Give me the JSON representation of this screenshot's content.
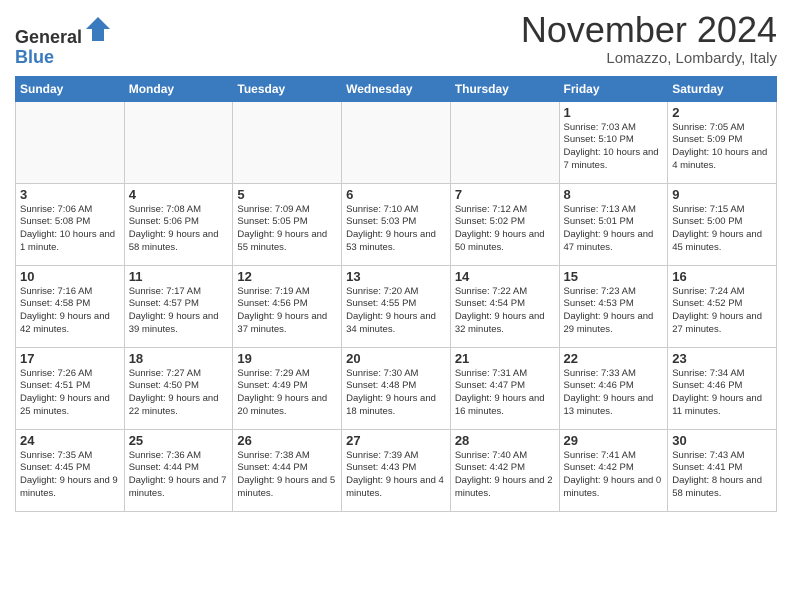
{
  "header": {
    "logo_line1": "General",
    "logo_line2": "Blue",
    "month": "November 2024",
    "location": "Lomazzo, Lombardy, Italy"
  },
  "weekdays": [
    "Sunday",
    "Monday",
    "Tuesday",
    "Wednesday",
    "Thursday",
    "Friday",
    "Saturday"
  ],
  "weeks": [
    [
      {
        "day": "",
        "info": ""
      },
      {
        "day": "",
        "info": ""
      },
      {
        "day": "",
        "info": ""
      },
      {
        "day": "",
        "info": ""
      },
      {
        "day": "",
        "info": ""
      },
      {
        "day": "1",
        "info": "Sunrise: 7:03 AM\nSunset: 5:10 PM\nDaylight: 10 hours and 7 minutes."
      },
      {
        "day": "2",
        "info": "Sunrise: 7:05 AM\nSunset: 5:09 PM\nDaylight: 10 hours and 4 minutes."
      }
    ],
    [
      {
        "day": "3",
        "info": "Sunrise: 7:06 AM\nSunset: 5:08 PM\nDaylight: 10 hours and 1 minute."
      },
      {
        "day": "4",
        "info": "Sunrise: 7:08 AM\nSunset: 5:06 PM\nDaylight: 9 hours and 58 minutes."
      },
      {
        "day": "5",
        "info": "Sunrise: 7:09 AM\nSunset: 5:05 PM\nDaylight: 9 hours and 55 minutes."
      },
      {
        "day": "6",
        "info": "Sunrise: 7:10 AM\nSunset: 5:03 PM\nDaylight: 9 hours and 53 minutes."
      },
      {
        "day": "7",
        "info": "Sunrise: 7:12 AM\nSunset: 5:02 PM\nDaylight: 9 hours and 50 minutes."
      },
      {
        "day": "8",
        "info": "Sunrise: 7:13 AM\nSunset: 5:01 PM\nDaylight: 9 hours and 47 minutes."
      },
      {
        "day": "9",
        "info": "Sunrise: 7:15 AM\nSunset: 5:00 PM\nDaylight: 9 hours and 45 minutes."
      }
    ],
    [
      {
        "day": "10",
        "info": "Sunrise: 7:16 AM\nSunset: 4:58 PM\nDaylight: 9 hours and 42 minutes."
      },
      {
        "day": "11",
        "info": "Sunrise: 7:17 AM\nSunset: 4:57 PM\nDaylight: 9 hours and 39 minutes."
      },
      {
        "day": "12",
        "info": "Sunrise: 7:19 AM\nSunset: 4:56 PM\nDaylight: 9 hours and 37 minutes."
      },
      {
        "day": "13",
        "info": "Sunrise: 7:20 AM\nSunset: 4:55 PM\nDaylight: 9 hours and 34 minutes."
      },
      {
        "day": "14",
        "info": "Sunrise: 7:22 AM\nSunset: 4:54 PM\nDaylight: 9 hours and 32 minutes."
      },
      {
        "day": "15",
        "info": "Sunrise: 7:23 AM\nSunset: 4:53 PM\nDaylight: 9 hours and 29 minutes."
      },
      {
        "day": "16",
        "info": "Sunrise: 7:24 AM\nSunset: 4:52 PM\nDaylight: 9 hours and 27 minutes."
      }
    ],
    [
      {
        "day": "17",
        "info": "Sunrise: 7:26 AM\nSunset: 4:51 PM\nDaylight: 9 hours and 25 minutes."
      },
      {
        "day": "18",
        "info": "Sunrise: 7:27 AM\nSunset: 4:50 PM\nDaylight: 9 hours and 22 minutes."
      },
      {
        "day": "19",
        "info": "Sunrise: 7:29 AM\nSunset: 4:49 PM\nDaylight: 9 hours and 20 minutes."
      },
      {
        "day": "20",
        "info": "Sunrise: 7:30 AM\nSunset: 4:48 PM\nDaylight: 9 hours and 18 minutes."
      },
      {
        "day": "21",
        "info": "Sunrise: 7:31 AM\nSunset: 4:47 PM\nDaylight: 9 hours and 16 minutes."
      },
      {
        "day": "22",
        "info": "Sunrise: 7:33 AM\nSunset: 4:46 PM\nDaylight: 9 hours and 13 minutes."
      },
      {
        "day": "23",
        "info": "Sunrise: 7:34 AM\nSunset: 4:46 PM\nDaylight: 9 hours and 11 minutes."
      }
    ],
    [
      {
        "day": "24",
        "info": "Sunrise: 7:35 AM\nSunset: 4:45 PM\nDaylight: 9 hours and 9 minutes."
      },
      {
        "day": "25",
        "info": "Sunrise: 7:36 AM\nSunset: 4:44 PM\nDaylight: 9 hours and 7 minutes."
      },
      {
        "day": "26",
        "info": "Sunrise: 7:38 AM\nSunset: 4:44 PM\nDaylight: 9 hours and 5 minutes."
      },
      {
        "day": "27",
        "info": "Sunrise: 7:39 AM\nSunset: 4:43 PM\nDaylight: 9 hours and 4 minutes."
      },
      {
        "day": "28",
        "info": "Sunrise: 7:40 AM\nSunset: 4:42 PM\nDaylight: 9 hours and 2 minutes."
      },
      {
        "day": "29",
        "info": "Sunrise: 7:41 AM\nSunset: 4:42 PM\nDaylight: 9 hours and 0 minutes."
      },
      {
        "day": "30",
        "info": "Sunrise: 7:43 AM\nSunset: 4:41 PM\nDaylight: 8 hours and 58 minutes."
      }
    ]
  ]
}
